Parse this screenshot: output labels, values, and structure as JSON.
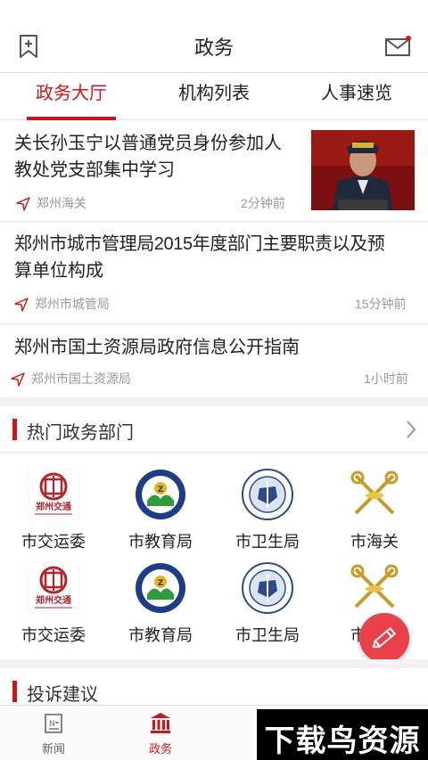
{
  "header": {
    "title": "政务",
    "bookmark_icon": "bookmark-add-icon",
    "mail_icon": "mail-icon",
    "accent": "#d0151a"
  },
  "tabs": [
    {
      "label": "政务大厅",
      "active": true
    },
    {
      "label": "机构列表",
      "active": false
    },
    {
      "label": "人事速览",
      "active": false
    }
  ],
  "news": [
    {
      "title_line1": "关长孙玉宁以普通党员身份参加人",
      "title_line2": "教处党支部集中学习",
      "source": "郑州海关",
      "time": "2分钟前"
    },
    {
      "title_line1": "郑州市城市管理局2015年度部门主要职责以及预",
      "title_line2": "算单位构成",
      "source": "郑州市城管局",
      "time": "15分钟前"
    },
    {
      "title_line1": "郑州市国土资源局政府信息公开指南",
      "source": "郑州市国土资源局",
      "time": "1小时前"
    }
  ],
  "hot_departments": {
    "label": "热门政务部门",
    "items": [
      {
        "name": "市交运委",
        "logo_text": "郑州交通"
      },
      {
        "name": "市教育局"
      },
      {
        "name": "市卫生局"
      },
      {
        "name": "市海关"
      },
      {
        "name": "市交运委",
        "logo_text": "郑州交通"
      },
      {
        "name": "市教育局"
      },
      {
        "name": "市卫生局"
      },
      {
        "name": "市海关"
      }
    ]
  },
  "complaints": {
    "label": "投诉建议"
  },
  "bottom_nav": [
    {
      "label": "新闻",
      "icon": "news-icon",
      "active": false
    },
    {
      "label": "政务",
      "icon": "government-building-icon",
      "active": true
    }
  ],
  "watermark": "下载鸟资源"
}
